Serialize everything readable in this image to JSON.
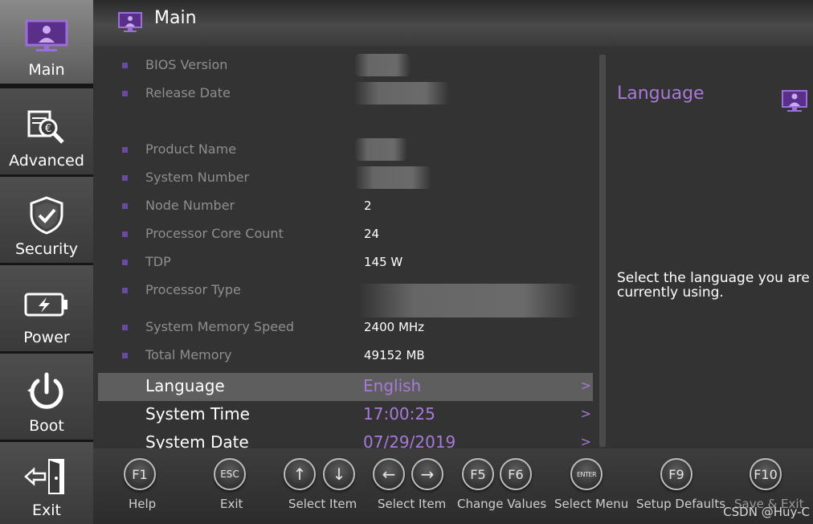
{
  "sidebar": {
    "items": [
      {
        "label": "Main",
        "icon": "monitor-icon",
        "active": true
      },
      {
        "label": "Advanced",
        "icon": "magnify-chip-icon",
        "active": false
      },
      {
        "label": "Security",
        "icon": "shield-check-icon",
        "active": false
      },
      {
        "label": "Power",
        "icon": "battery-icon",
        "active": false
      },
      {
        "label": "Boot",
        "icon": "power-icon",
        "active": false
      },
      {
        "label": "Exit",
        "icon": "exit-door-icon",
        "active": false
      }
    ]
  },
  "header": {
    "title": "Main",
    "icon": "monitor-icon"
  },
  "info_rows": [
    {
      "label": "BIOS Version",
      "value": ""
    },
    {
      "label": "Release Date",
      "value": ""
    },
    {
      "label": "Product Name",
      "value": ""
    },
    {
      "label": "System Number",
      "value": ""
    },
    {
      "label": "Node Number",
      "value": "2"
    },
    {
      "label": "Processor Core Count",
      "value": "24"
    },
    {
      "label": "TDP",
      "value": "145 W"
    },
    {
      "label": "Processor Type",
      "value": ""
    },
    {
      "label": "System Memory Speed",
      "value": "2400 MHz"
    },
    {
      "label": "Total Memory",
      "value": "49152 MB"
    }
  ],
  "settings": [
    {
      "label": "Language",
      "value": "English",
      "selected": true
    },
    {
      "label": "System Time",
      "value": "17:00:25",
      "selected": false
    },
    {
      "label": "System Date",
      "value": "07/29/2019",
      "selected": false
    }
  ],
  "chevron": ">",
  "help": {
    "title": "Language",
    "description": "Select the language you are currently using."
  },
  "footer": {
    "keys": [
      {
        "keys": [
          "F1"
        ],
        "caption": "Help"
      },
      {
        "keys": [
          "ESC"
        ],
        "caption": "Exit"
      },
      {
        "keys": [
          "↑",
          "↓"
        ],
        "caption": "Select Item"
      },
      {
        "keys": [
          "←",
          "→"
        ],
        "caption": "Select Item"
      },
      {
        "keys": [
          "F5",
          "F6"
        ],
        "caption": "Change Values"
      },
      {
        "keys": [
          "ENTER"
        ],
        "caption": "Select Menu"
      },
      {
        "keys": [
          "F9"
        ],
        "caption": "Setup Defaults"
      },
      {
        "keys": [
          "F10"
        ],
        "caption": "Save & Exit"
      }
    ]
  },
  "watermark": "CSDN @Huy-C",
  "colors": {
    "accent": "#a77ad8",
    "bullet": "#6a4aa0",
    "background": "#333333"
  }
}
